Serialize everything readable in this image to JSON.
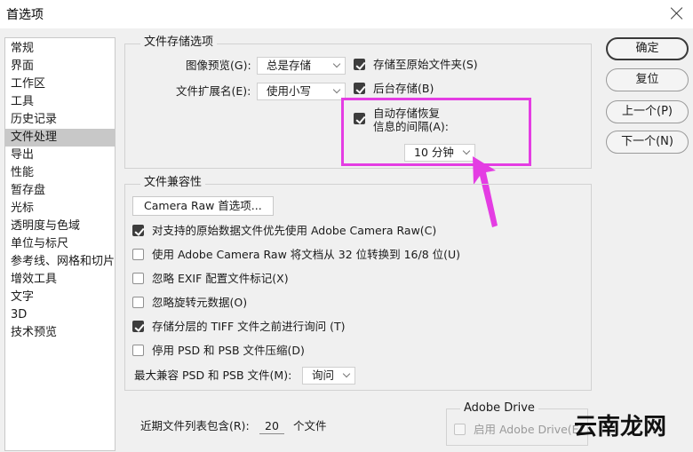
{
  "window": {
    "title": "首选项"
  },
  "sidebar": {
    "items": [
      {
        "label": "常规",
        "selected": false
      },
      {
        "label": "界面",
        "selected": false
      },
      {
        "label": "工作区",
        "selected": false
      },
      {
        "label": "工具",
        "selected": false
      },
      {
        "label": "历史记录",
        "selected": false
      },
      {
        "label": "文件处理",
        "selected": true
      },
      {
        "label": "导出",
        "selected": false
      },
      {
        "label": "性能",
        "selected": false
      },
      {
        "label": "暂存盘",
        "selected": false
      },
      {
        "label": "光标",
        "selected": false
      },
      {
        "label": "透明度与色域",
        "selected": false
      },
      {
        "label": "单位与标尺",
        "selected": false
      },
      {
        "label": "参考线、网格和切片",
        "selected": false
      },
      {
        "label": "增效工具",
        "selected": false
      },
      {
        "label": "文字",
        "selected": false
      },
      {
        "label": "3D",
        "selected": false
      },
      {
        "label": "技术预览",
        "selected": false
      }
    ]
  },
  "file_saving": {
    "group_title": "文件存储选项",
    "image_preview_label": "图像预览(G):",
    "image_preview_value": "总是存储",
    "file_ext_label": "文件扩展名(E):",
    "file_ext_value": "使用小写",
    "save_original_folder": {
      "label": "存储至原始文件夹(S)",
      "checked": true
    },
    "background_save": {
      "label": "后台存储(B)",
      "checked": true
    },
    "auto_recover": {
      "label_line1": "自动存储恢复",
      "label_line2": "信息的间隔(A):",
      "checked": true
    },
    "interval_value": "10 分钟"
  },
  "compat": {
    "group_title": "文件兼容性",
    "camera_raw_button": "Camera Raw 首选项...",
    "options": [
      {
        "label": "对支持的原始数据文件优先使用 Adobe Camera Raw(C)",
        "checked": true
      },
      {
        "label": "使用 Adobe Camera Raw 将文档从 32 位转换到 16/8 位(U)",
        "checked": false
      },
      {
        "label": "忽略 EXIF 配置文件标记(X)",
        "checked": false
      },
      {
        "label": "忽略旋转元数据(O)",
        "checked": false
      },
      {
        "label": "存储分层的 TIFF 文件之前进行询问 (T)",
        "checked": true
      },
      {
        "label": "停用 PSD 和 PSB 文件压缩(D)",
        "checked": false
      }
    ],
    "max_compat_label": "最大兼容 PSD 和 PSB 文件(M):",
    "max_compat_value": "询问"
  },
  "recent": {
    "label": "近期文件列表包含(R):",
    "value": "20",
    "unit": "个文件"
  },
  "adobe_drive": {
    "group_title": "Adobe Drive",
    "enable_label": "启用 Adobe Drive(E)",
    "checked": false
  },
  "buttons": {
    "ok": "确定",
    "reset": "复位",
    "prev": "上一个(P)",
    "next": "下一个(N)"
  },
  "watermark": "云南龙网",
  "colors": {
    "highlight": "#e43de3",
    "selected_item": "#c8c8c8"
  }
}
